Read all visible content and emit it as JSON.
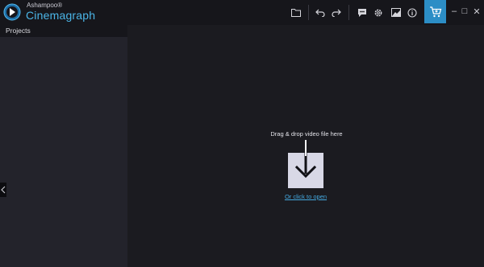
{
  "app": {
    "brand_sub": "Ashampoo®",
    "brand_name": "Cinemagraph"
  },
  "toolbar": {
    "icons": [
      "folder-icon",
      "undo-icon",
      "redo-icon",
      "chat-icon",
      "settings-icon",
      "image-icon",
      "info-icon",
      "cart-icon"
    ]
  },
  "window_controls": {
    "minimize_glyph": "–",
    "maximize_glyph": "□",
    "close_glyph": "✕"
  },
  "sidebar": {
    "title": "Projects"
  },
  "main": {
    "drop_text": "Drag & drop video file here",
    "open_link": "Or click to open"
  },
  "colors": {
    "accent_blue": "#2c8ec6",
    "link_blue": "#44a9e0",
    "background": "#1b1b20",
    "panel": "#23232b"
  }
}
